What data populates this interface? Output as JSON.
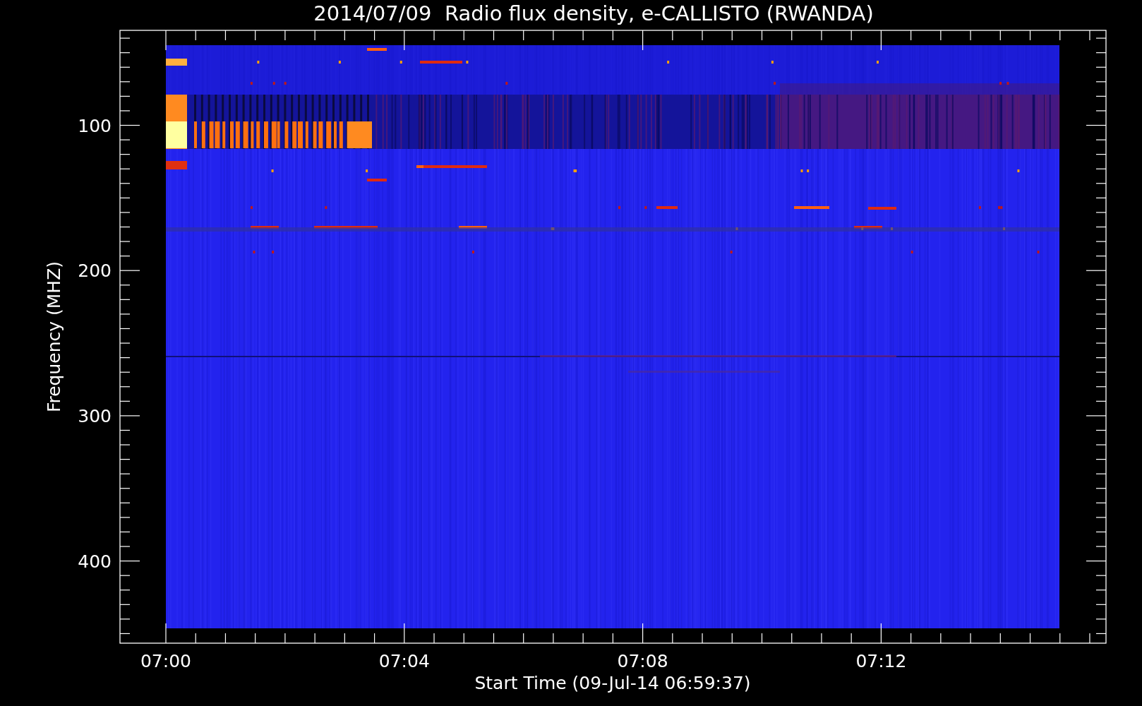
{
  "title": "2014/07/09  Radio flux density, e-CALLISTO (RWANDA)",
  "plot": {
    "ylabel": "Frequency (MHZ)",
    "xlabel": "Start Time (09-Jul-14 06:59:37)",
    "yticks": [
      "100",
      "200",
      "300",
      "400"
    ],
    "xticks": [
      "07:00",
      "07:04",
      "07:08",
      "07:12"
    ]
  }
}
